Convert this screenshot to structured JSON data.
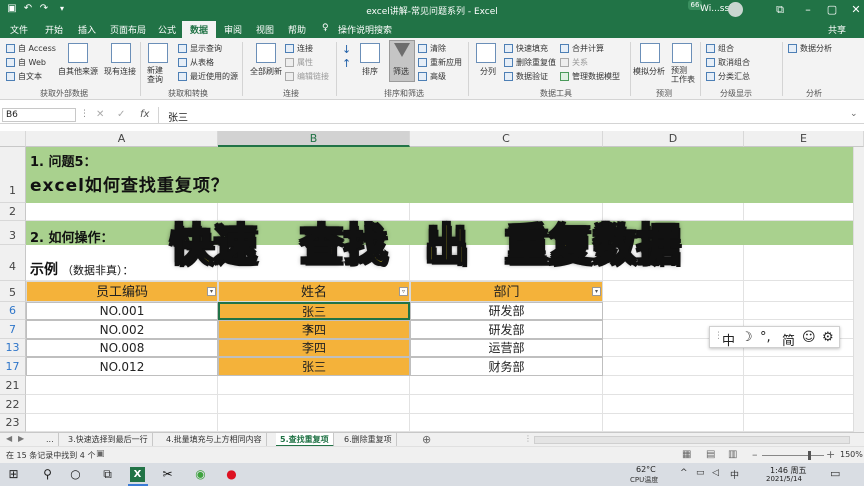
{
  "window": {
    "title": "excel讲解-常见问题系列 - Excel",
    "user": "Wi...ssica",
    "badge": "66"
  },
  "tabs": [
    "文件",
    "开始",
    "插入",
    "页面布局",
    "公式",
    "数据",
    "审阅",
    "视图",
    "帮助",
    "操作说明搜索"
  ],
  "active_tab": "数据",
  "ribbon": {
    "get_external": {
      "items": [
        "自 Access",
        "自 Web",
        "自文本",
        "自其他来源",
        "现有连接"
      ],
      "label": "获取外部数据"
    },
    "transform": {
      "items": [
        "新建\n查询",
        "显示查询",
        "从表格",
        "最近使用的源"
      ],
      "label": "获取和转换"
    },
    "connections": {
      "items": [
        "全部刷新",
        "连接",
        "属性",
        "编辑链接"
      ],
      "label": "连接"
    },
    "sort_filter": {
      "items": [
        "排序",
        "筛选",
        "清除",
        "重新应用",
        "高级"
      ],
      "label": "排序和筛选"
    },
    "data_tools": {
      "items": [
        "分列",
        "快速填充",
        "删除重复值",
        "数据验证",
        "合并计算",
        "关系",
        "管理数据模型"
      ],
      "label": "数据工具"
    },
    "forecast": {
      "items": [
        "模拟分析",
        "预测\n工作表"
      ],
      "label": "预测"
    },
    "outline": {
      "items": [
        "组合",
        "取消组合",
        "分类汇总"
      ],
      "label": "分级显示"
    },
    "analysis": {
      "items": [
        "数据分析"
      ],
      "label": "分析"
    },
    "share": "共享"
  },
  "formula_bar": {
    "name_box": "B6",
    "fx": "fx",
    "value": "张三"
  },
  "columns": [
    "A",
    "B",
    "C",
    "D",
    "E"
  ],
  "rows": [
    "1",
    "2",
    "3",
    "4",
    "5",
    "6",
    "7",
    "13",
    "17",
    "21",
    "22",
    "23"
  ],
  "sheet": {
    "r1_line1": "1. 问题5：",
    "r1_line2": "excel如何查找重复项？",
    "r3": "2. 如何操作：",
    "r4_label": "示例",
    "r4_note": "（数据非真）：",
    "headers": [
      "员工编码",
      "姓名",
      "部门"
    ],
    "data": [
      [
        "NO.001",
        "张三",
        "研发部"
      ],
      [
        "NO.002",
        "李四",
        "研发部"
      ],
      [
        "NO.008",
        "李四",
        "运营部"
      ],
      [
        "NO.012",
        "张三",
        "财务部"
      ]
    ]
  },
  "overlay": [
    "快速",
    "查找",
    "出",
    "重复数据"
  ],
  "ime": [
    "中",
    "☽",
    "°,",
    "简",
    "☺",
    "⚙"
  ],
  "sheet_tabs": [
    "...",
    "3.快速选择到最后一行",
    "4.批量填充与上方相同内容",
    "5.查找重复项",
    "6.删除重复项"
  ],
  "active_sheet": "5.查找重复项",
  "status": {
    "text": "在 15 条记录中找到 4 个",
    "zoom": "150%"
  },
  "taskbar": {
    "weather": "62°C",
    "weather_sub": "CPU温度",
    "time": "1:46 周五",
    "date": "2021/5/14"
  },
  "colors": {
    "excel_green": "#217346",
    "band_green": "#a9d18e",
    "orange": "#f4b23a",
    "title_yellow": "#f5e625"
  }
}
